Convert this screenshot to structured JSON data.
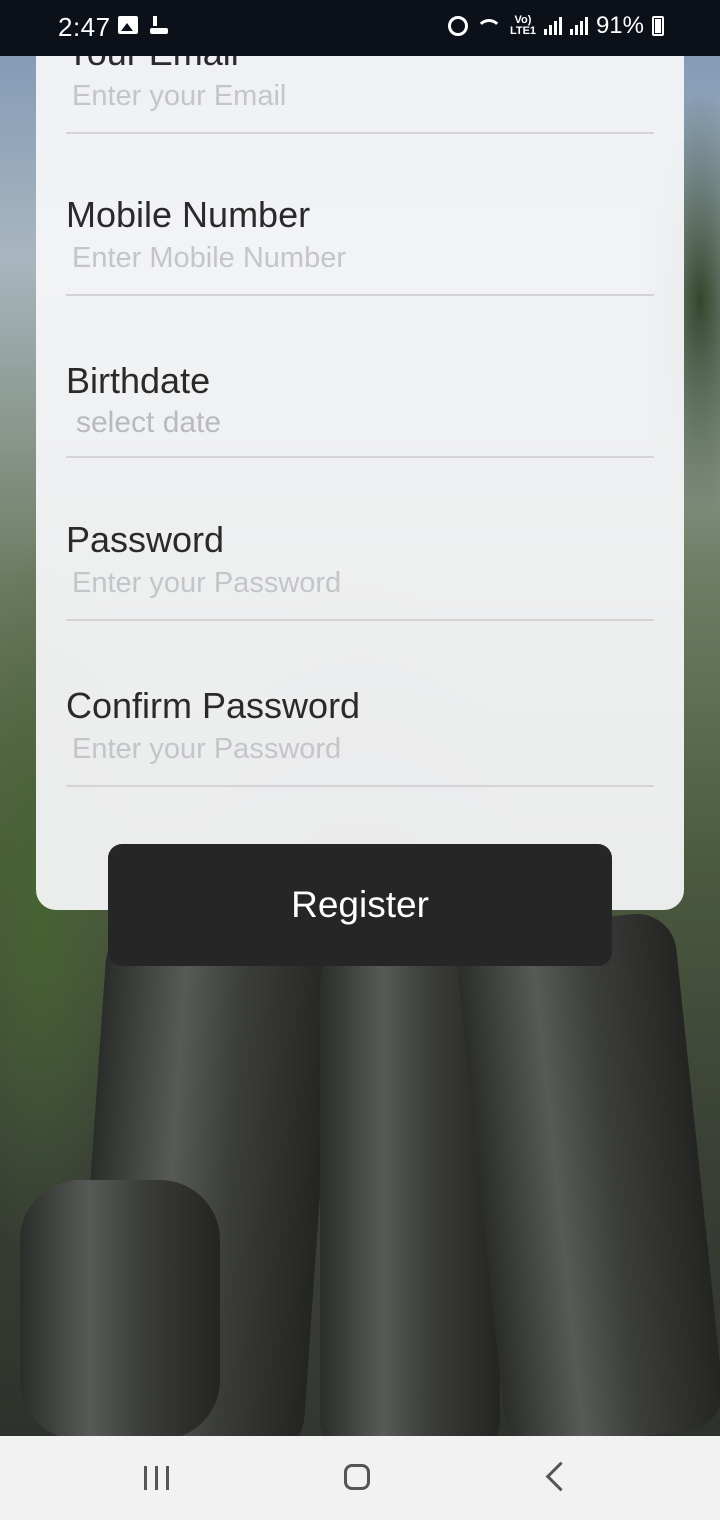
{
  "status_bar": {
    "time": "2:47",
    "lte_label": "Vo) LTE1",
    "battery_percent": "91%",
    "battery_level": 0.91,
    "icons": [
      "image-icon",
      "app-notification-icon",
      "alarm-icon",
      "wifi-icon",
      "signal-icon",
      "battery-charging-icon"
    ]
  },
  "form": {
    "email": {
      "label": "Your Email",
      "placeholder": "Enter your Email"
    },
    "mobile": {
      "label": "Mobile Number",
      "placeholder": "Enter Mobile Number"
    },
    "birthdate": {
      "label": "Birthdate",
      "placeholder": "select date"
    },
    "password": {
      "label": "Password",
      "placeholder": "Enter your Password"
    },
    "confirm_password": {
      "label": "Confirm Password",
      "placeholder": "Enter your Password"
    },
    "register_label": "Register"
  },
  "nav_bar": {
    "icons": [
      "recents-icon",
      "home-icon",
      "back-icon"
    ]
  }
}
